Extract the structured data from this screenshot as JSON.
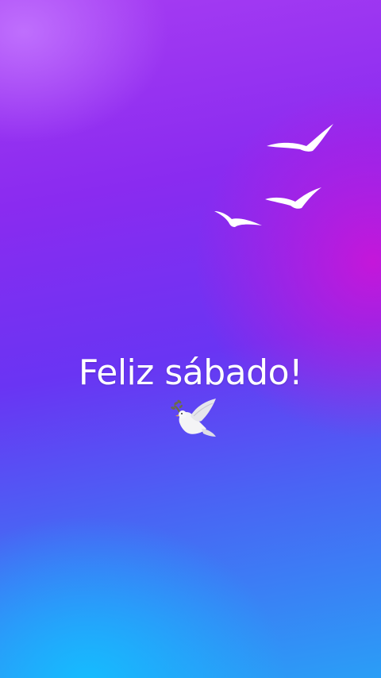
{
  "story": {
    "greeting_text": "Feliz sábado!",
    "emoji_icon": "dove-with-olive-branch-icon",
    "decor_icon": "flying-birds-icon",
    "colors": {
      "top": "#a63cf2",
      "middle": "#6a34f3",
      "bottom": "#2a9ef6",
      "accent_magenta": "#cd14d7",
      "text": "#ffffff"
    }
  }
}
